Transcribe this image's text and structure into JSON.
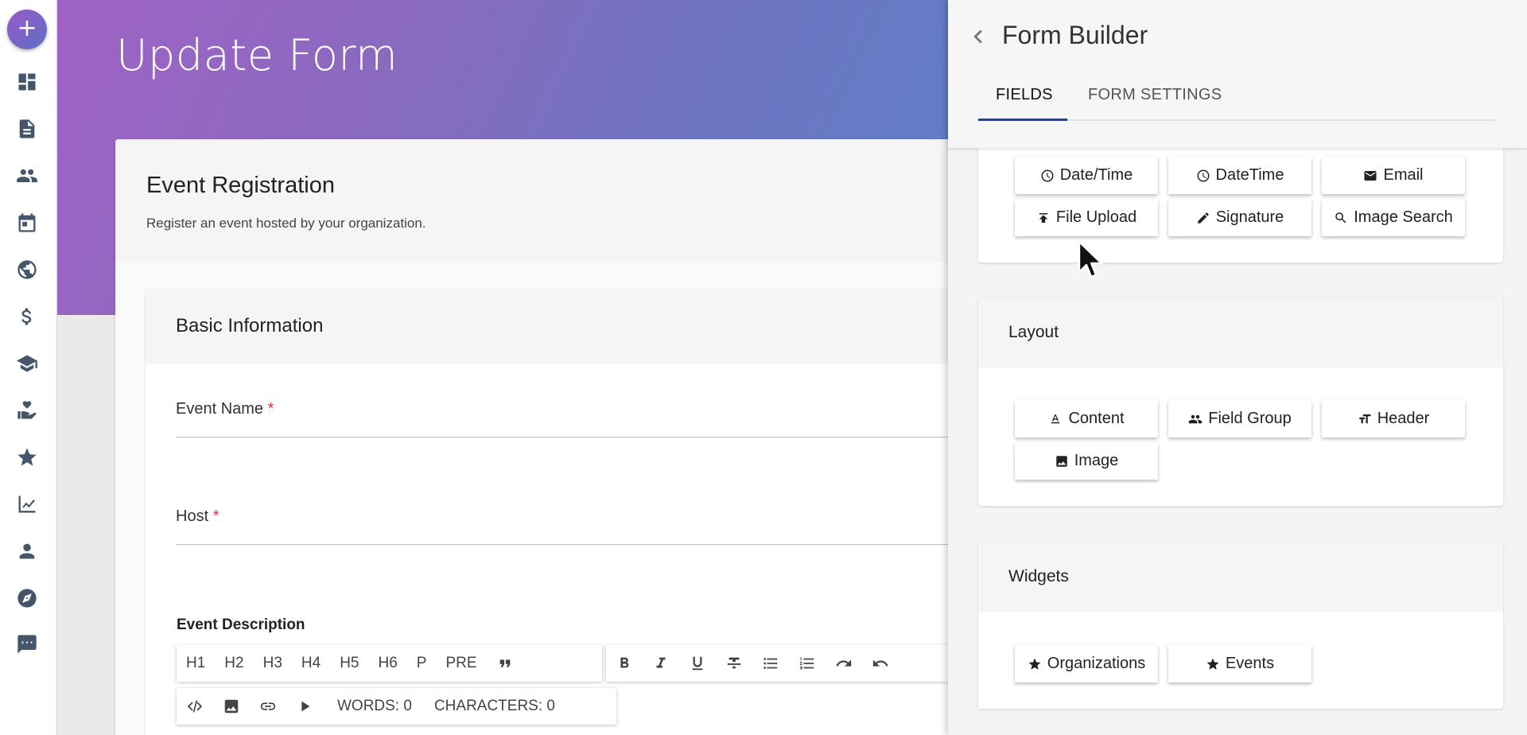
{
  "app": {
    "add_button": "+"
  },
  "rail": {
    "items": [
      {
        "icon": "dashboard-icon"
      },
      {
        "icon": "document-icon"
      },
      {
        "icon": "people-icon"
      },
      {
        "icon": "calendar-icon"
      },
      {
        "icon": "globe-icon"
      },
      {
        "icon": "dollar-icon"
      },
      {
        "icon": "graduation-cap-icon"
      },
      {
        "icon": "hand-heart-icon"
      },
      {
        "icon": "star-icon"
      },
      {
        "icon": "chart-icon"
      },
      {
        "icon": "person-icon"
      },
      {
        "icon": "compass-icon"
      },
      {
        "icon": "sms-icon"
      }
    ]
  },
  "page": {
    "title": "Update Form"
  },
  "form": {
    "title": "Event Registration",
    "subtitle": "Register an event hosted by your organization.",
    "section_title": "Basic Information",
    "fields": [
      {
        "label": "Event Name",
        "required": "*"
      },
      {
        "label": "Host",
        "required": "*"
      }
    ],
    "description_label": "Event Description",
    "toolbar_row1": [
      "H1",
      "H2",
      "H3",
      "H4",
      "H5",
      "H6",
      "P",
      "PRE"
    ],
    "toolbar_icons": [
      "quote-icon",
      "bold-icon",
      "italic-icon",
      "underline-icon",
      "strikethrough-icon",
      "bullet-list-icon",
      "numbered-list-icon",
      "redo-icon",
      "undo-icon"
    ],
    "toolbar_row2": {
      "words": "WORDS: 0",
      "characters": "CHARACTERS: 0"
    }
  },
  "panel": {
    "title": "Form Builder",
    "tabs": [
      "FIELDS",
      "FORM SETTINGS"
    ],
    "active_tab": "FIELDS",
    "fields_buttons": [
      {
        "label": "Date/Time",
        "icon": "clock-icon"
      },
      {
        "label": "DateTime",
        "icon": "clock-icon"
      },
      {
        "label": "Email",
        "icon": "email-icon"
      },
      {
        "label": "File Upload",
        "icon": "upload-icon"
      },
      {
        "label": "Signature",
        "icon": "pencil-icon"
      },
      {
        "label": "Image Search",
        "icon": "search-icon"
      }
    ],
    "layout": {
      "title": "Layout",
      "buttons": [
        {
          "label": "Content",
          "icon": "text-format-icon"
        },
        {
          "label": "Field Group",
          "icon": "group-icon"
        },
        {
          "label": "Header",
          "icon": "title-icon"
        },
        {
          "label": "Image",
          "icon": "image-icon"
        }
      ]
    },
    "widgets": {
      "title": "Widgets",
      "buttons": [
        {
          "label": "Organizations",
          "icon": "star-icon"
        },
        {
          "label": "Events",
          "icon": "star-icon"
        }
      ]
    }
  },
  "colors": {
    "accent": "#1e40af",
    "required": "#e53935",
    "hero_start": "#a062c6",
    "hero_end": "#5f80c8"
  }
}
